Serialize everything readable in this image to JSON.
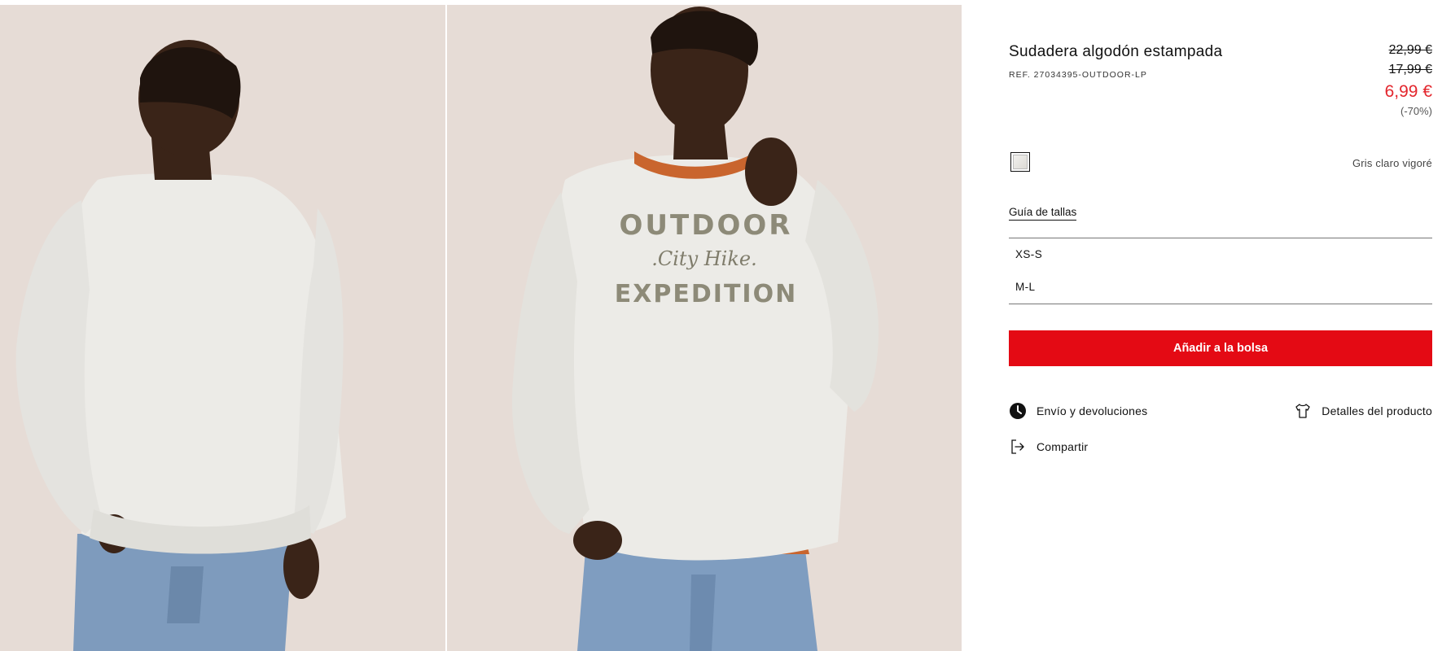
{
  "gallery": {
    "images": [
      {
        "alt": "back-view",
        "icon": "photo-back"
      },
      {
        "alt": "front-view",
        "icon": "photo-front"
      }
    ],
    "print_text": {
      "line1": "OUTDOOR",
      "line2": ".City Hike.",
      "line3": "EXPEDITION"
    }
  },
  "product": {
    "title": "Sudadera algodón estampada",
    "ref": "REF. 27034395-OUTDOOR-LP",
    "prices": {
      "original": "22,99 €",
      "previous": "17,99 €",
      "current": "6,99 €",
      "discount": "(-70%)"
    },
    "color": {
      "name": "Gris claro vigoré",
      "swatch_hex": "#e8e6e2"
    },
    "size_guide_label": "Guía de tallas",
    "sizes": [
      "XS-S",
      "M-L"
    ],
    "add_to_bag_label": "Añadir a la bolsa",
    "links": {
      "shipping": "Envío y devoluciones",
      "details": "Detalles del producto",
      "share": "Compartir"
    }
  },
  "theme": {
    "accent_red": "#e40a14",
    "sale_red": "#e3262d",
    "photo_bg": "#e6dcd6"
  }
}
